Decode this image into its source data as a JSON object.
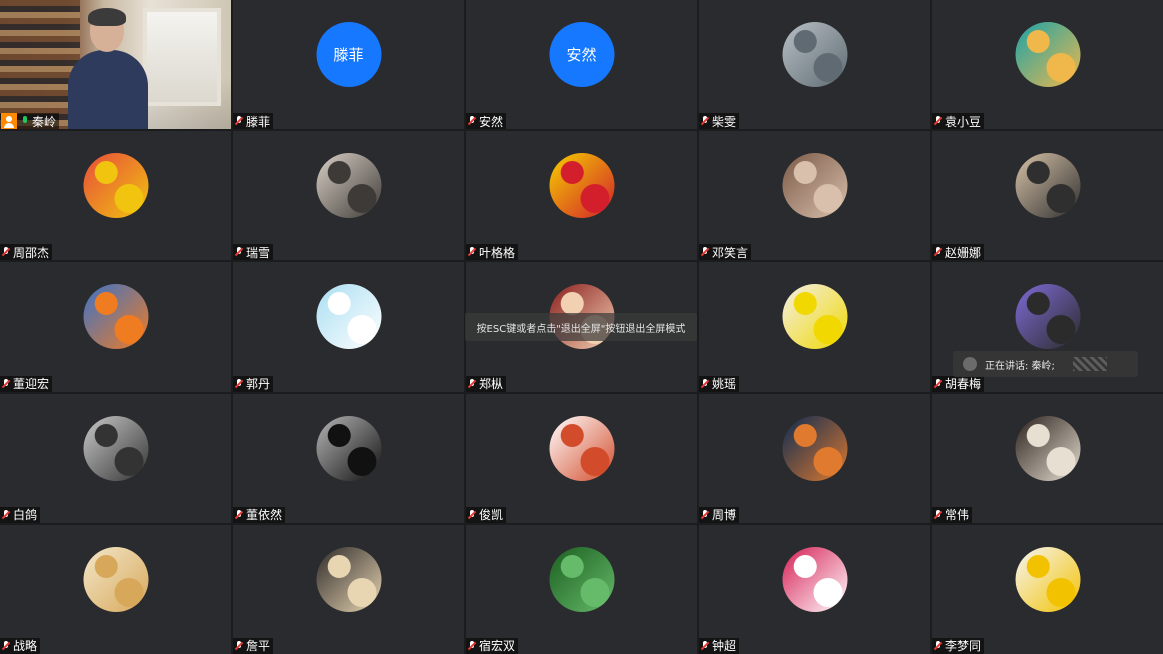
{
  "participants": [
    {
      "name": "秦岭",
      "type": "video",
      "active": true
    },
    {
      "name": "滕菲",
      "type": "text",
      "avatar_text": "滕菲"
    },
    {
      "name": "安然",
      "type": "text",
      "avatar_text": "安然"
    },
    {
      "name": "柴雯",
      "type": "image",
      "colors": [
        "#b8c0c6",
        "#5f6a72"
      ]
    },
    {
      "name": "袁小豆",
      "type": "image",
      "colors": [
        "#1aa3a8",
        "#f0b84b"
      ]
    },
    {
      "name": "周邵杰",
      "type": "image",
      "colors": [
        "#e74c3c",
        "#f1c40f"
      ]
    },
    {
      "name": "瑞雪",
      "type": "image",
      "colors": [
        "#d9d0c5",
        "#3e3a38"
      ]
    },
    {
      "name": "叶格格",
      "type": "image",
      "colors": [
        "#f5d000",
        "#d21f2b"
      ]
    },
    {
      "name": "邓笑言",
      "type": "image",
      "colors": [
        "#7b5a47",
        "#d8c0ad"
      ]
    },
    {
      "name": "赵姗娜",
      "type": "image",
      "colors": [
        "#d6c2a7",
        "#2f2f2f"
      ]
    },
    {
      "name": "董迎宏",
      "type": "image",
      "colors": [
        "#3a73c9",
        "#f07c22"
      ]
    },
    {
      "name": "郭丹",
      "type": "image",
      "colors": [
        "#a9def2",
        "#ffffff"
      ]
    },
    {
      "name": "郑枞",
      "type": "image",
      "colors": [
        "#8b1e1e",
        "#f2d1b3"
      ]
    },
    {
      "name": "姚瑶",
      "type": "image",
      "colors": [
        "#f3efe8",
        "#f0d800"
      ]
    },
    {
      "name": "胡春梅",
      "type": "image",
      "colors": [
        "#7f6bd6",
        "#2b2b2b"
      ]
    },
    {
      "name": "白鸽",
      "type": "image",
      "colors": [
        "#c9c9c9",
        "#333333"
      ]
    },
    {
      "name": "董依然",
      "type": "image",
      "colors": [
        "#b6b6b6",
        "#111111"
      ]
    },
    {
      "name": "俊凯",
      "type": "image",
      "colors": [
        "#ffffff",
        "#d24b2a"
      ]
    },
    {
      "name": "周博",
      "type": "image",
      "colors": [
        "#0c2b52",
        "#e07a2f"
      ]
    },
    {
      "name": "常伟",
      "type": "image",
      "colors": [
        "#2b211d",
        "#e7e0d2"
      ]
    },
    {
      "name": "战略",
      "type": "image",
      "colors": [
        "#f3e7c9",
        "#d7a85a"
      ]
    },
    {
      "name": "詹平",
      "type": "image",
      "colors": [
        "#2f2b2a",
        "#e8d6b3"
      ]
    },
    {
      "name": "宿宏双",
      "type": "image",
      "colors": [
        "#1b5e20",
        "#66bb6a"
      ]
    },
    {
      "name": "钟超",
      "type": "image",
      "colors": [
        "#d61f55",
        "#ffffff"
      ]
    },
    {
      "name": "李梦同",
      "type": "image",
      "colors": [
        "#f5f5f5",
        "#f2c200"
      ]
    }
  ],
  "notices": {
    "fullscreen_exit": "按ESC键或者点击\"退出全屏\"按钮退出全屏模式",
    "speaking_label": "正在讲话: 秦岭;"
  }
}
